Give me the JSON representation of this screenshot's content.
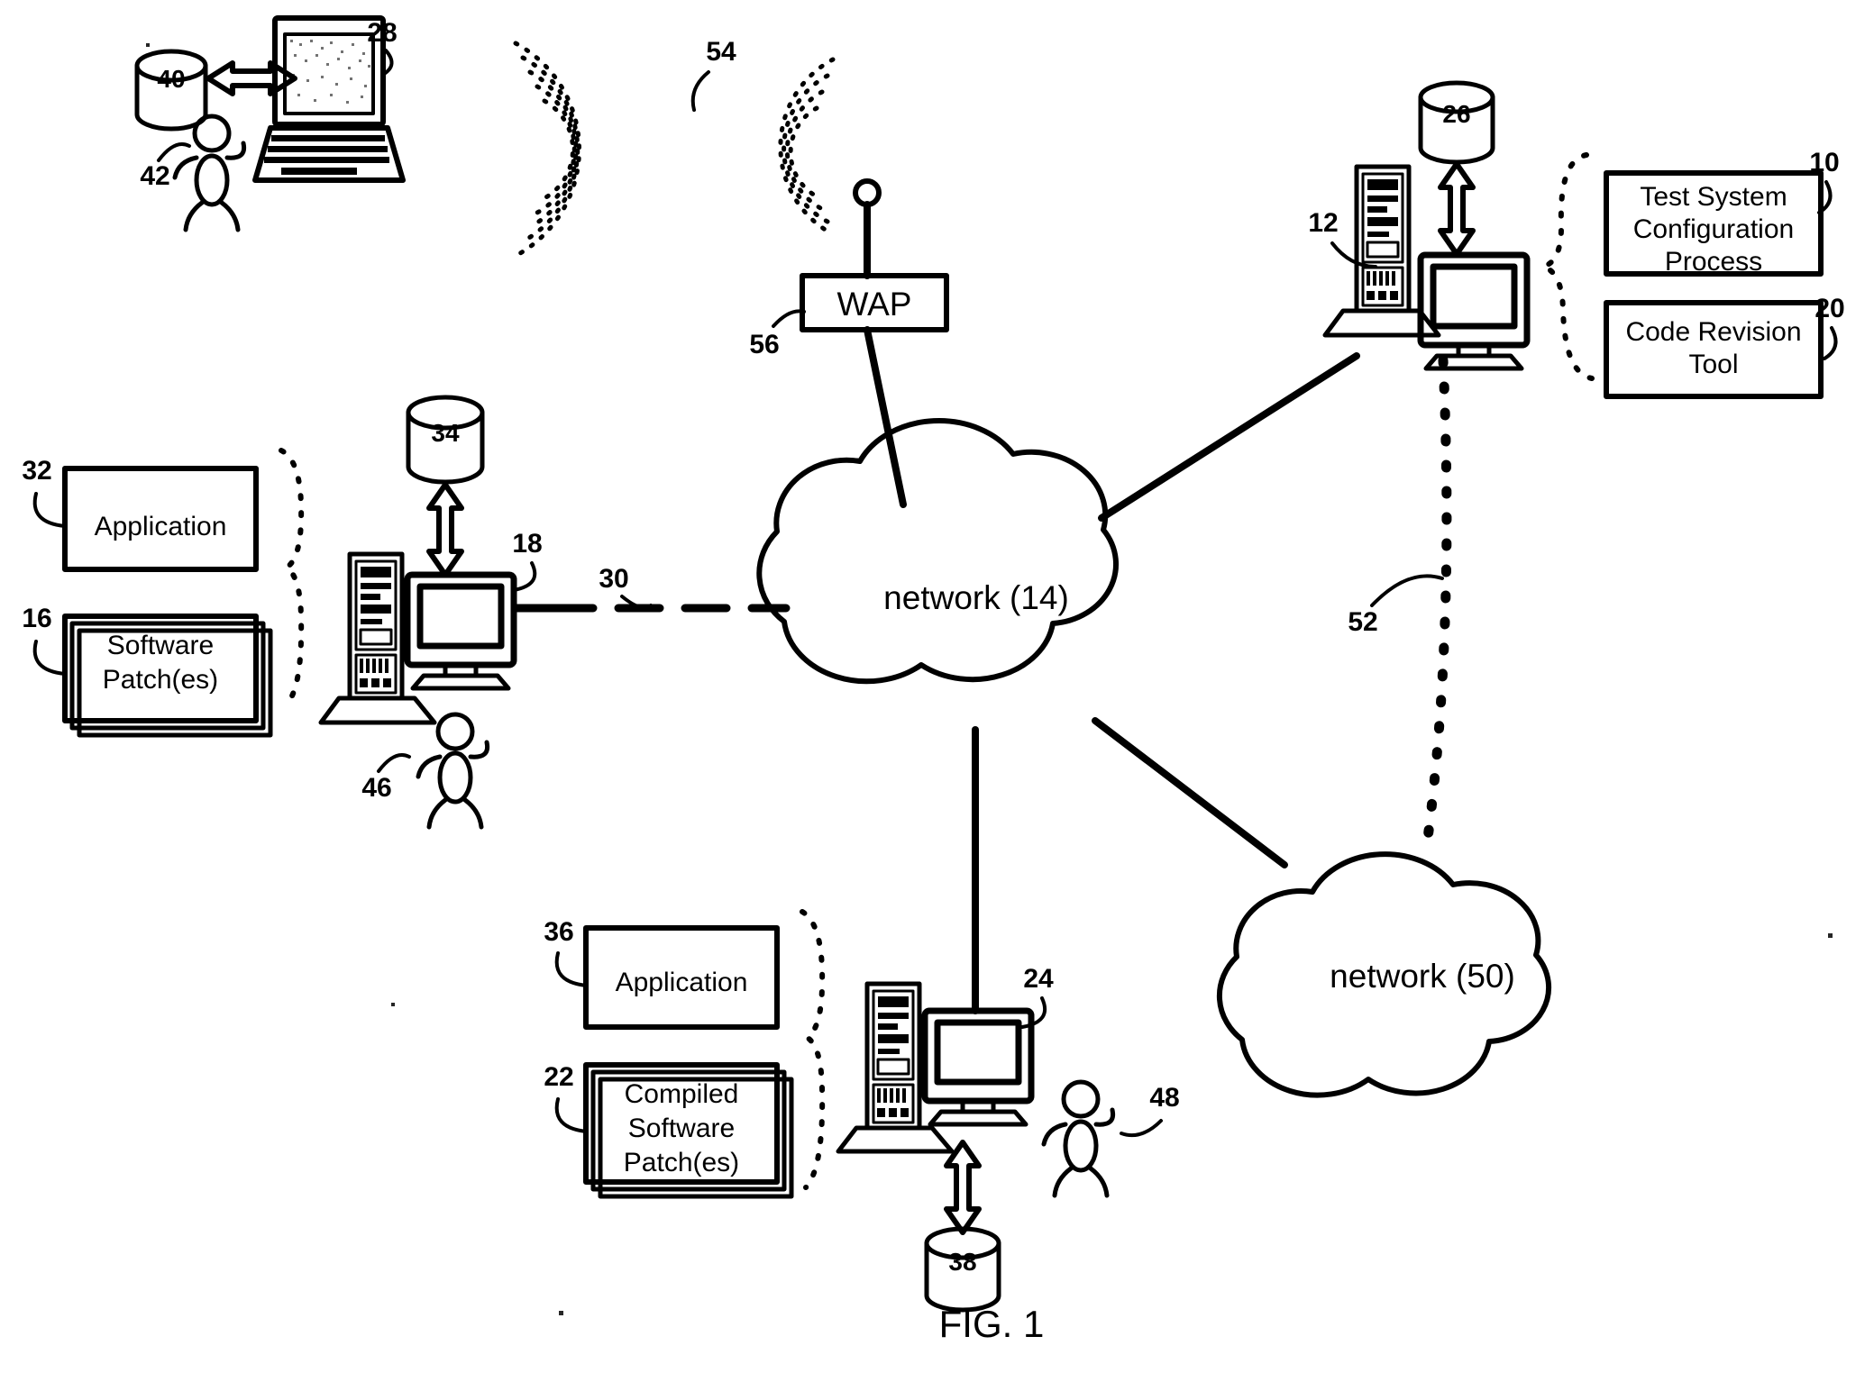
{
  "figure": {
    "caption": "FIG. 1",
    "type": "patent-network-diagram"
  },
  "boxes": {
    "test_system_configuration_process": {
      "label": "Test System\nConfiguration\nProcess",
      "line1": "Test System",
      "line2": "Configuration",
      "line3": "Process",
      "ref": "10"
    },
    "code_revision_tool": {
      "line1": "Code Revision",
      "line2": "Tool",
      "ref": "20"
    },
    "application_left": {
      "line1": "Application",
      "ref": "32"
    },
    "software_patches": {
      "line1": "Software",
      "line2": "Patch(es)",
      "ref": "16"
    },
    "application_bottom": {
      "line1": "Application",
      "ref": "36"
    },
    "compiled_software_patches": {
      "line1": "Compiled",
      "line2": "Software",
      "line3": "Patch(es)",
      "ref": "22"
    },
    "wap": {
      "label": "WAP",
      "ref": "56"
    }
  },
  "clouds": [
    {
      "name": "network-14",
      "label": "network (14)"
    },
    {
      "name": "network-50",
      "label": "network (50)"
    }
  ],
  "storage_cylinders": [
    {
      "name": "storage-40",
      "label": "40"
    },
    {
      "name": "storage-34",
      "label": "34"
    },
    {
      "name": "storage-26",
      "label": "26"
    },
    {
      "name": "storage-38",
      "label": "38"
    }
  ],
  "reference_numerals": {
    "test_process": "10",
    "server_top_right": "12",
    "network_main": "14",
    "software_patches": "16",
    "workstation_left": "18",
    "code_revision_tool": "20",
    "compiled_patches": "22",
    "workstation_bottom": "24",
    "storage_26": "26",
    "laptop_28": "28",
    "link_30": "30",
    "application_32": "32",
    "storage_34": "34",
    "application_36": "36",
    "storage_38": "38",
    "storage_40": "40",
    "user_42": "42",
    "user_46": "46",
    "user_48": "48",
    "network_50": "50",
    "link_52": "52",
    "wireless_54": "54",
    "wap_56": "56"
  },
  "users": [
    {
      "name": "user-42",
      "ref": "42"
    },
    {
      "name": "user-46",
      "ref": "46"
    },
    {
      "name": "user-48",
      "ref": "48"
    }
  ],
  "devices": [
    {
      "name": "laptop-28",
      "ref": "28"
    },
    {
      "name": "server-12",
      "ref": "12"
    },
    {
      "name": "workstation-18",
      "ref": "18"
    },
    {
      "name": "workstation-24",
      "ref": "24"
    }
  ],
  "colors": {
    "ink": "#000000",
    "paper": "#ffffff"
  }
}
